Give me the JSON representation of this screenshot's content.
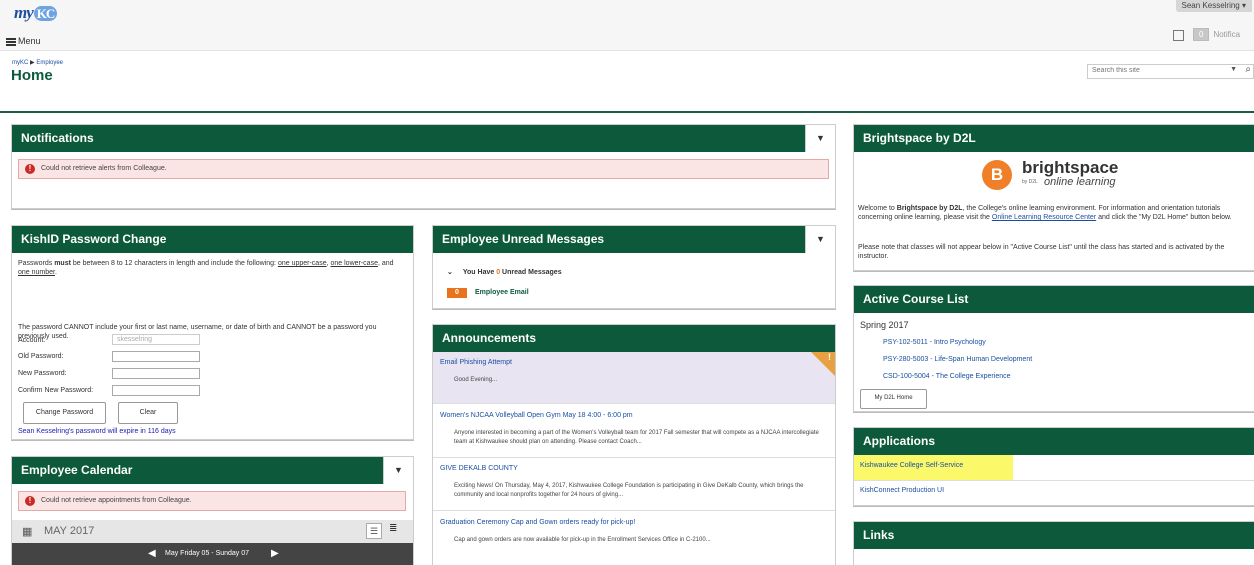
{
  "header": {
    "logo_text": "my",
    "logo_kc": "KC",
    "menu_label": "Menu",
    "user_name": "Sean Kesselring ▾",
    "notifications_count": "0",
    "notifications_label": "Notifica"
  },
  "breadcrumb": {
    "root": "myKC",
    "separator": "▶",
    "current": "Employee"
  },
  "page_title": "Home",
  "search": {
    "placeholder": "Search this site"
  },
  "notifications_panel": {
    "title": "Notifications",
    "error": "Could not retrieve alerts from Colleague."
  },
  "password_panel": {
    "title": "KishID Password Change",
    "rules_pre": "Passwords ",
    "rules_must": "must",
    "rules_mid": " be between 8 to 12 characters in length and include the following: ",
    "rules_upper": "one upper-case",
    "rules_comma": ", ",
    "rules_lower": "one lower-case",
    "rules_and": ", and ",
    "rules_number": "one number",
    "rules_end": ".",
    "cannot_text": "The password CANNOT include your first or last name, username, or date of birth and CANNOT be a password you previously used.",
    "account_label": "Account:",
    "account_value": "skesselring",
    "old_label": "Old Password:",
    "new_label": "New Password:",
    "confirm_label": "Confirm New Password:",
    "change_button": "Change Password",
    "clear_button": "Clear",
    "expire_text": "Sean Kesselring's password will expire in 116 days"
  },
  "calendar_panel": {
    "title": "Employee Calendar",
    "error": "Could not retrieve appointments from Colleague.",
    "month": "MAY 2017",
    "range": "May Friday 05 - Sunday 07"
  },
  "messages_panel": {
    "title": "Employee Unread Messages",
    "summary_pre": "You Have ",
    "summary_count": "0",
    "summary_post": " Unread Messages",
    "email_count": "0",
    "email_label": "Employee Email"
  },
  "announcements_panel": {
    "title": "Announcements",
    "items": [
      {
        "title": "Email Phishing Attempt",
        "body": "Good Evening..."
      },
      {
        "title": "Women's NJCAA Volleyball Open Gym May 18 4:00 - 6:00 pm",
        "body": "Anyone interested in becoming a part of the Women's Volleyball team for 2017 Fall semester that will compete as a NJCAA intercollegiate team at Kishwaukee should plan on attending.  Please contact Coach..."
      },
      {
        "title": "GIVE DEKALB COUNTY",
        "body": "Exciting News! On Thursday, May 4, 2017, Kishwaukee College Foundation is participating in Give DeKalb County, which brings the community and local nonprofits together for 24 hours of giving..."
      },
      {
        "title": "Graduation Ceremony Cap and Gown orders ready for pick-up!",
        "body": "Cap and gown orders are now available for pick-up in the Enrollment Services Office in C-2100..."
      }
    ]
  },
  "brightspace_panel": {
    "title": "Brightspace by D2L",
    "logo_word": "brightspace",
    "logo_by": "by D2L",
    "logo_sub": "online learning",
    "p1_a": "Welcome to ",
    "p1_b": "Brightspace by D2L",
    "p1_c": ", the College's online learning environment. For information and orientation tutorials concerning online learning, please visit the ",
    "p1_link": "Online Learning Resource Center",
    "p1_d": " and click the \"My D2L Home\" button below.",
    "p2": "Please note that classes will not appear below in \"Active Course List\" until the class has started and is activated by the instructor."
  },
  "courses_panel": {
    "title": "Active Course List",
    "term": "Spring 2017",
    "courses": [
      "PSY-102-5011 - Intro Psychology",
      "PSY-280-5003 - Life-Span Human Development",
      "CSD-100-5004 - The College Experience"
    ],
    "home_button": "My D2L Home"
  },
  "applications_panel": {
    "title": "Applications",
    "items": [
      "Kishwaukee College Self-Service",
      "KishConnect Production UI"
    ],
    "highlight_color": "#fbf96a"
  },
  "links_panel": {
    "title": "Links"
  },
  "colors": {
    "header_green": "#0c5a3b",
    "link_blue": "#1a4fa0",
    "error_red": "#c92b27",
    "orange": "#e8731c"
  }
}
